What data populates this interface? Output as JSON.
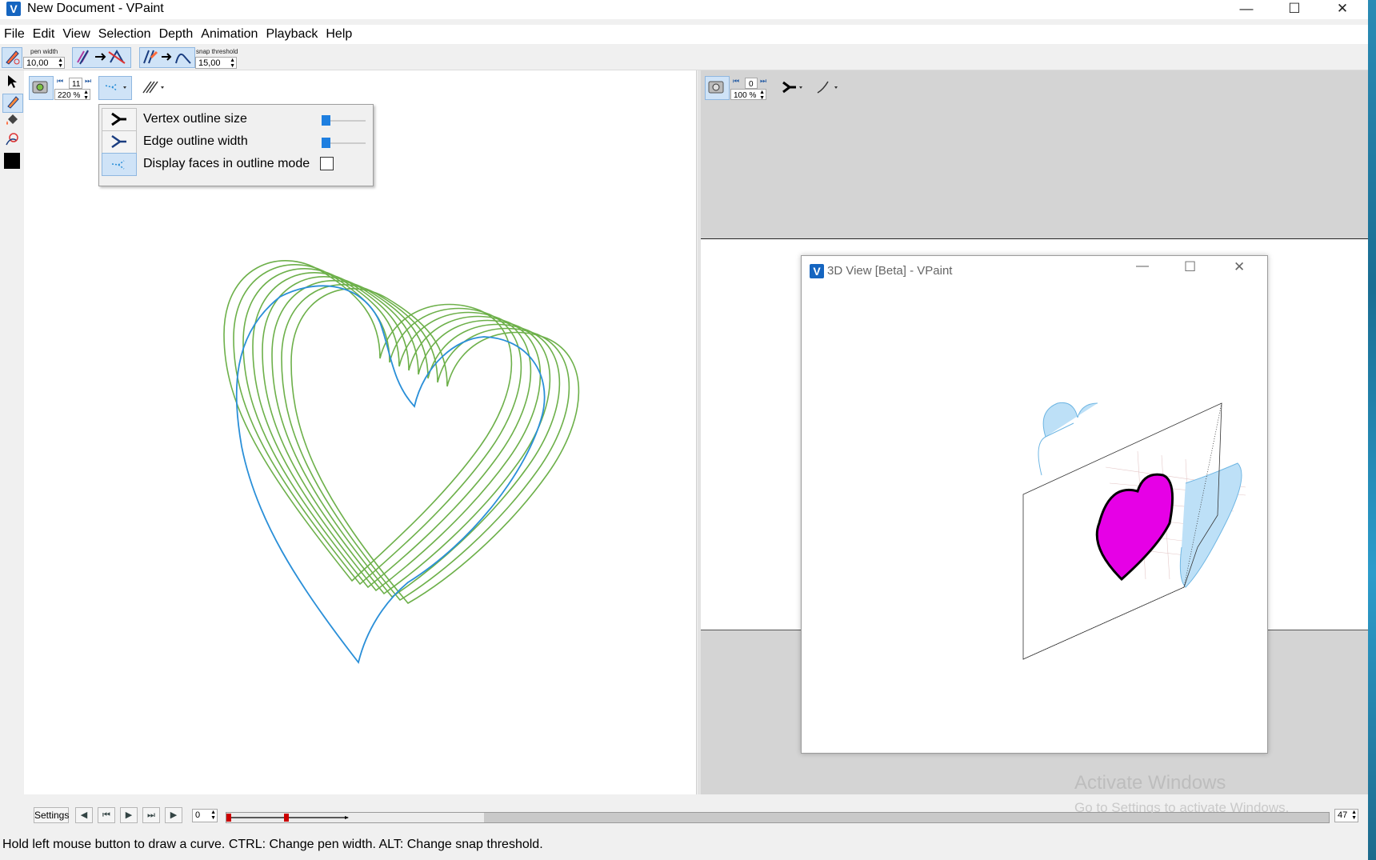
{
  "window": {
    "title": "New Document - VPaint",
    "logo": "V"
  },
  "menu": [
    "File",
    "Edit",
    "View",
    "Selection",
    "Depth",
    "Animation",
    "Playback",
    "Help"
  ],
  "toolbar": {
    "pen_width_label": "pen width",
    "pen_width_value": "10,00",
    "snap_threshold_label": "snap threshold",
    "snap_threshold_value": "15,00"
  },
  "left_view": {
    "frame": "11",
    "zoom": "220 %"
  },
  "right_view": {
    "frame": "0",
    "zoom": "100 %"
  },
  "display_popup": {
    "vertex_outline_size": "Vertex outline size",
    "edge_outline_width": "Edge outline width",
    "display_faces_outline": "Display faces in outline mode",
    "display_faces_checked": false
  },
  "window3d": {
    "title": "3D View [Beta] - VPaint",
    "logo": "V"
  },
  "colors": {
    "green_stroke": "#6db04a",
    "blue_stroke": "#2a8fd8",
    "magenta": "#e600e6",
    "light_blue": "#bde0f7"
  },
  "timeline": {
    "settings_label": "Settings",
    "current_frame": "0",
    "end_frame": "47"
  },
  "watermark": {
    "line1": "Activate Windows",
    "line2": "Go to Settings to activate Windows."
  },
  "status": "Hold left mouse button to draw a curve. CTRL: Change pen width. ALT: Change snap threshold."
}
